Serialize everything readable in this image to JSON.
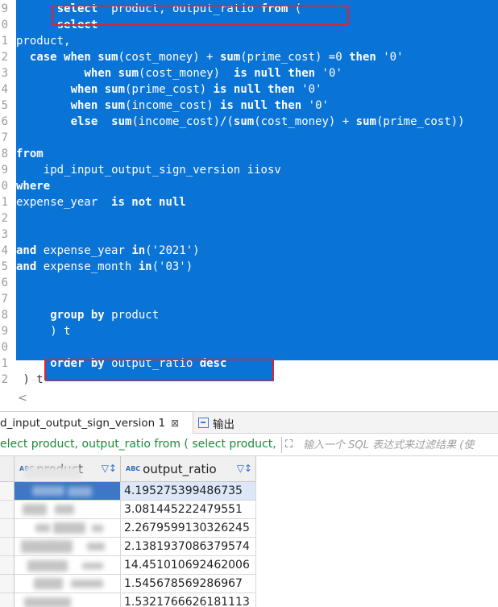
{
  "editor": {
    "gutter_numbers": [
      "9",
      "0",
      "1",
      "2",
      "3",
      "4",
      "5",
      "6",
      "7",
      "8",
      "9",
      "0",
      "1",
      "2",
      "3",
      "4",
      "5",
      "6",
      "7",
      "8",
      "9",
      "0",
      "1",
      "2"
    ],
    "lines": [
      {
        "indent": 6,
        "segments": [
          {
            "t": "select",
            "k": true
          },
          {
            "t": "  product, output_ratio ",
            "k": false
          },
          {
            "t": "from",
            "k": true
          },
          {
            "t": " (",
            "k": false
          }
        ]
      },
      {
        "indent": 6,
        "segments": [
          {
            "t": "select",
            "k": true
          }
        ]
      },
      {
        "indent": 0,
        "segments": [
          {
            "t": "product,",
            "k": false
          }
        ]
      },
      {
        "indent": 2,
        "segments": [
          {
            "t": "case",
            "k": true
          },
          {
            "t": " ",
            "k": false
          },
          {
            "t": "when",
            "k": true
          },
          {
            "t": " ",
            "k": false
          },
          {
            "t": "sum",
            "k": true
          },
          {
            "t": "(cost_money) + ",
            "k": false
          },
          {
            "t": "sum",
            "k": true
          },
          {
            "t": "(prime_cost) =0 ",
            "k": false
          },
          {
            "t": "then",
            "k": true
          },
          {
            "t": " '0'",
            "k": false
          }
        ]
      },
      {
        "indent": 10,
        "segments": [
          {
            "t": "when",
            "k": true
          },
          {
            "t": " ",
            "k": false
          },
          {
            "t": "sum",
            "k": true
          },
          {
            "t": "(cost_money)  ",
            "k": false
          },
          {
            "t": "is null then",
            "k": true
          },
          {
            "t": " '0'",
            "k": false
          }
        ]
      },
      {
        "indent": 8,
        "segments": [
          {
            "t": "when",
            "k": true
          },
          {
            "t": " ",
            "k": false
          },
          {
            "t": "sum",
            "k": true
          },
          {
            "t": "(prime_cost) ",
            "k": false
          },
          {
            "t": "is null then",
            "k": true
          },
          {
            "t": " '0'",
            "k": false
          }
        ]
      },
      {
        "indent": 8,
        "segments": [
          {
            "t": "when",
            "k": true
          },
          {
            "t": " ",
            "k": false
          },
          {
            "t": "sum",
            "k": true
          },
          {
            "t": "(income_cost) ",
            "k": false
          },
          {
            "t": "is null then",
            "k": true
          },
          {
            "t": " '0'",
            "k": false
          }
        ]
      },
      {
        "indent": 8,
        "segments": [
          {
            "t": "else",
            "k": true
          },
          {
            "t": "  ",
            "k": false
          },
          {
            "t": "sum",
            "k": true
          },
          {
            "t": "(income_cost)/(",
            "k": false
          },
          {
            "t": "sum",
            "k": true
          },
          {
            "t": "(cost_money) + ",
            "k": false
          },
          {
            "t": "sum",
            "k": true
          },
          {
            "t": "(prime_cost))",
            "k": false
          }
        ]
      },
      {
        "indent": 0,
        "segments": []
      },
      {
        "indent": 0,
        "segments": [
          {
            "t": "from",
            "k": true
          }
        ]
      },
      {
        "indent": 4,
        "segments": [
          {
            "t": "ipd_input_output_sign_version iiosv",
            "k": false
          }
        ]
      },
      {
        "indent": 0,
        "segments": [
          {
            "t": "where",
            "k": true
          }
        ]
      },
      {
        "indent": 0,
        "segments": [
          {
            "t": "expense_year  ",
            "k": false
          },
          {
            "t": "is not null",
            "k": true
          }
        ]
      },
      {
        "indent": 0,
        "segments": []
      },
      {
        "indent": 0,
        "segments": []
      },
      {
        "indent": 0,
        "segments": [
          {
            "t": "and",
            "k": true
          },
          {
            "t": " expense_year ",
            "k": false
          },
          {
            "t": "in",
            "k": true
          },
          {
            "t": "('2021')",
            "k": false
          }
        ]
      },
      {
        "indent": 0,
        "segments": [
          {
            "t": "and",
            "k": true
          },
          {
            "t": " expense_month ",
            "k": false
          },
          {
            "t": "in",
            "k": true
          },
          {
            "t": "('03')",
            "k": false
          }
        ]
      },
      {
        "indent": 0,
        "segments": []
      },
      {
        "indent": 0,
        "segments": []
      },
      {
        "indent": 5,
        "segments": [
          {
            "t": "group by",
            "k": true
          },
          {
            "t": " product",
            "k": false
          }
        ]
      },
      {
        "indent": 5,
        "segments": [
          {
            "t": ") t",
            "k": false
          }
        ]
      },
      {
        "indent": 0,
        "segments": []
      },
      {
        "indent": 5,
        "segments": [
          {
            "t": "order by",
            "k": true
          },
          {
            "t": " output_ratio ",
            "k": false
          },
          {
            "t": "desc",
            "k": true
          }
        ]
      },
      {
        "indent": 1,
        "segments": [
          {
            "t": ") t",
            "k": false
          }
        ],
        "plain": true
      }
    ],
    "scroll_left_glyph": "<"
  },
  "result_tabs": {
    "result_tab_label": "d_input_output_sign_version 1",
    "close_glyph": "⊠",
    "output_tab_label": "输出"
  },
  "filter_bar": {
    "query_text": "elect product, output_ratio from ( select product,",
    "filter_icon": "⛶",
    "placeholder": "输入一个 SQL 表达式来过滤结果 (使"
  },
  "grid": {
    "columns": [
      {
        "name": "product",
        "type_badge": "ABC",
        "sort_glyph": "▽↕"
      },
      {
        "name": "output_ratio",
        "type_badge": "ABC",
        "sort_glyph": "▽↕"
      }
    ],
    "rows": [
      {
        "output_ratio": "4.195275399486735"
      },
      {
        "output_ratio": "3.081445222479551"
      },
      {
        "output_ratio": "2.2679599130326245"
      },
      {
        "output_ratio": "2.1381937086379574"
      },
      {
        "output_ratio": "14.451010692462006"
      },
      {
        "output_ratio": "1.545678569286967"
      },
      {
        "output_ratio": "1.5321766626181113"
      }
    ]
  },
  "colors": {
    "selection": "#0a73d6",
    "highlight_box": "#e4212c",
    "query_text": "#1e8a3a",
    "selected_row": "#3d78c7"
  }
}
